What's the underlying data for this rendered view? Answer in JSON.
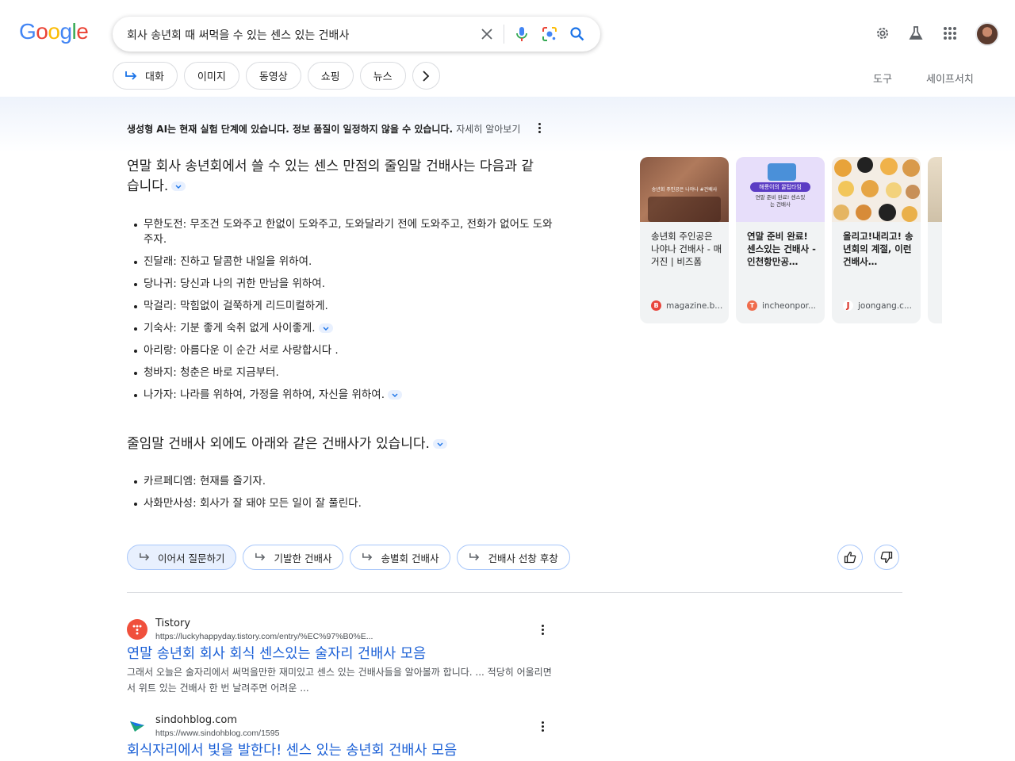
{
  "logo": {
    "letters": [
      "G",
      "o",
      "o",
      "g",
      "l",
      "e"
    ],
    "colors": [
      "#4285F4",
      "#EA4335",
      "#FBBC05",
      "#4285F4",
      "#34A853",
      "#EA4335"
    ]
  },
  "search": {
    "query": "회사 송년회 때 써먹을 수 있는 센스 있는 건배사"
  },
  "tabs": [
    "대화",
    "이미지",
    "동영상",
    "쇼핑",
    "뉴스"
  ],
  "tools": {
    "tools_label": "도구",
    "safesearch_label": "세이프서치"
  },
  "ai_overview": {
    "disclaimer": "생성형 AI는 현재 실험 단계에 있습니다. 정보 품질이 일정하지 않을 수 있습니다.",
    "learn_more": "자세히 알아보기",
    "heading": "연말 회사 송년회에서 쓸 수 있는 센스 만점의 줄임말 건배사는 다음과 같습니다.",
    "items": [
      "무한도전: 무조건 도와주고 한없이 도와주고, 도와달라기 전에 도와주고, 전화가 없어도 도와주자.",
      "진달래: 진하고 달콤한 내일을 위하여.",
      "당나귀: 당신과 나의 귀한 만남을 위하여.",
      "막걸리: 막힘없이 걸쭉하게 리드미컬하게.",
      "기숙사: 기분 좋게 숙취 없게 사이좋게.",
      "아리랑: 아름다운 이 순간 서로 사랑합시다 .",
      "청바지: 청춘은 바로 지금부터.",
      "나가자: 나라를 위하여, 가정을 위하여, 자신을 위하여."
    ],
    "heading2": "줄임말 건배사 외에도 아래와 같은 건배사가 있습니다.",
    "items2": [
      "카르페디엠: 현재를 즐기자.",
      "사화만사성: 회사가 잘 돼야 모든 일이 잘 풀린다."
    ],
    "followups": [
      "이어서 질문하기",
      "기발한 건배사",
      "송별회 건배사",
      "건배사 선창 후창"
    ]
  },
  "source_cards": [
    {
      "title": "송년회 주인공은 나야나 건배사 - 매거진 | 비즈폼",
      "source": "magazine.b...",
      "img_caption": "송년회 주인공은 나야나 #건배사",
      "fav_letter": "B",
      "fav_color": "#e8453c"
    },
    {
      "title": "연말 준비 완료! 센스있는 건배사 - 인천항만공…",
      "source": "incheonpor...",
      "img_caption_top": "해룡이의 꿀팁타임",
      "img_caption": "연말 준비 완료! 센스있는 건배사",
      "fav_letter": "T",
      "fav_color": "#ef6c4c"
    },
    {
      "title": "올리고!내리고! 송년회의 계절, 이런 건배사…",
      "source": "joongang.c...",
      "fav_letter": "J",
      "fav_color": "#d93025"
    }
  ],
  "results": [
    {
      "site": "Tistory",
      "url": "https://luckyhappyday.tistory.com/entry/%EC%97%B0%E...",
      "title": "연말 송년회 회사 회식 센스있는 술자리 건배사 모음",
      "snippet": "그래서 오늘은 술자리에서 써먹을만한 재미있고 센스 있는 건배사들을 알아볼까 합니다. ... 적당히 어울리면서 위트 있는 건배사 한 번 날려주면 어려운 ..."
    },
    {
      "site": "sindohblog.com",
      "url": "https://www.sindohblog.com/1595",
      "title": "회식자리에서 빛을 발한다! 센스 있는 송년회 건배사 모음"
    }
  ]
}
